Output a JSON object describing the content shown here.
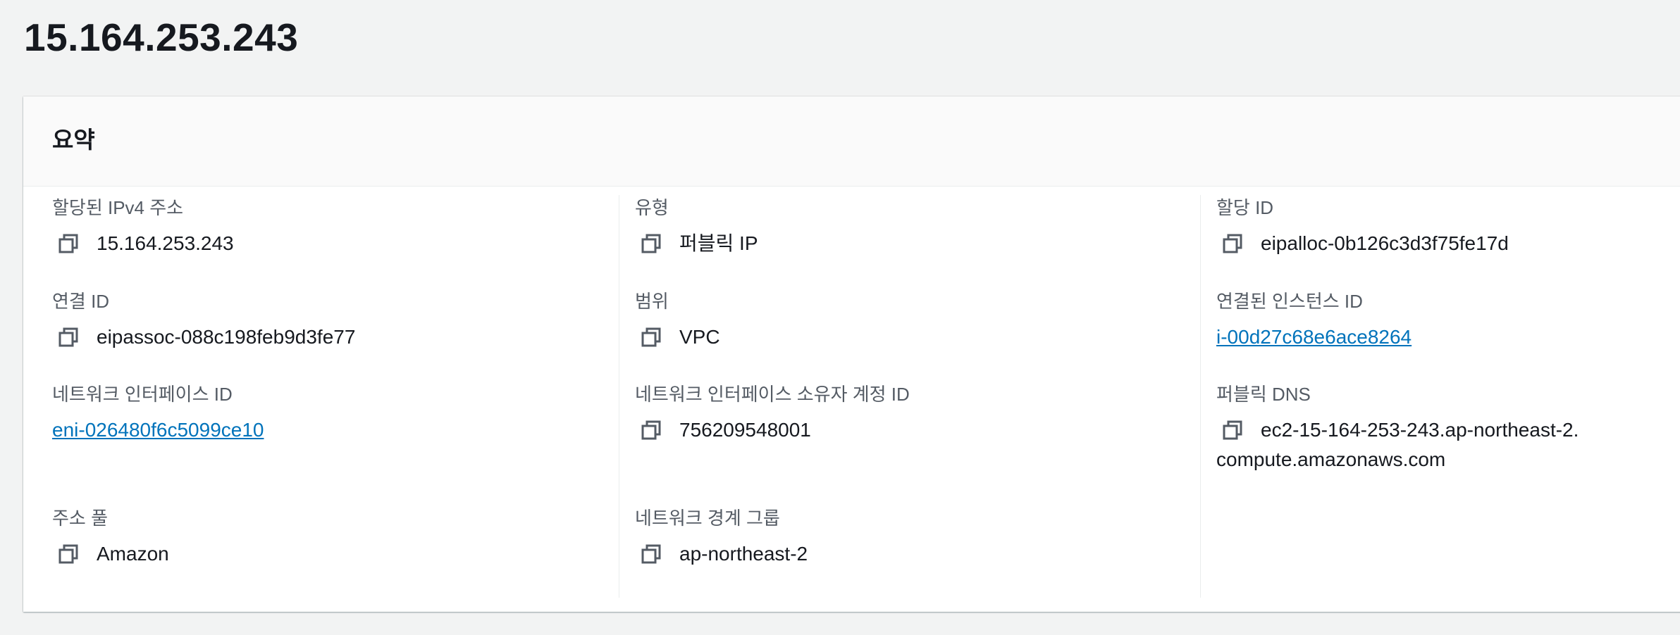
{
  "page": {
    "title": "15.164.253.243"
  },
  "summary": {
    "heading": "요약",
    "fields": {
      "allocated_ipv4": {
        "label": "할당된 IPv4 주소",
        "value": "15.164.253.243"
      },
      "association_id": {
        "label": "연결 ID",
        "value": "eipassoc-088c198feb9d3fe77"
      },
      "network_interface_id": {
        "label": "네트워크 인터페이스 ID",
        "value": "eni-026480f6c5099ce10"
      },
      "address_pool": {
        "label": "주소 풀",
        "value": "Amazon"
      },
      "type": {
        "label": "유형",
        "value": "퍼블릭 IP"
      },
      "scope": {
        "label": "범위",
        "value": "VPC"
      },
      "ni_owner_account_id": {
        "label": "네트워크 인터페이스 소유자 계정 ID",
        "value": "756209548001"
      },
      "network_border_group": {
        "label": "네트워크 경계 그룹",
        "value": "ap-northeast-2"
      },
      "allocation_id": {
        "label": "할당 ID",
        "value": "eipalloc-0b126c3d3f75fe17d"
      },
      "associated_instance_id": {
        "label": "연결된 인스턴스 ID",
        "value": "i-00d27c68e6ace8264"
      },
      "public_dns": {
        "label": "퍼블릭 DNS",
        "value": "ec2-15-164-253-243.ap-northeast-2.compute.amazonaws.com"
      }
    }
  },
  "icons": {
    "copy": "copy-icon"
  },
  "colors": {
    "link": "#0073bb",
    "label": "#545b64",
    "text": "#16191f",
    "background": "#f2f3f3"
  }
}
